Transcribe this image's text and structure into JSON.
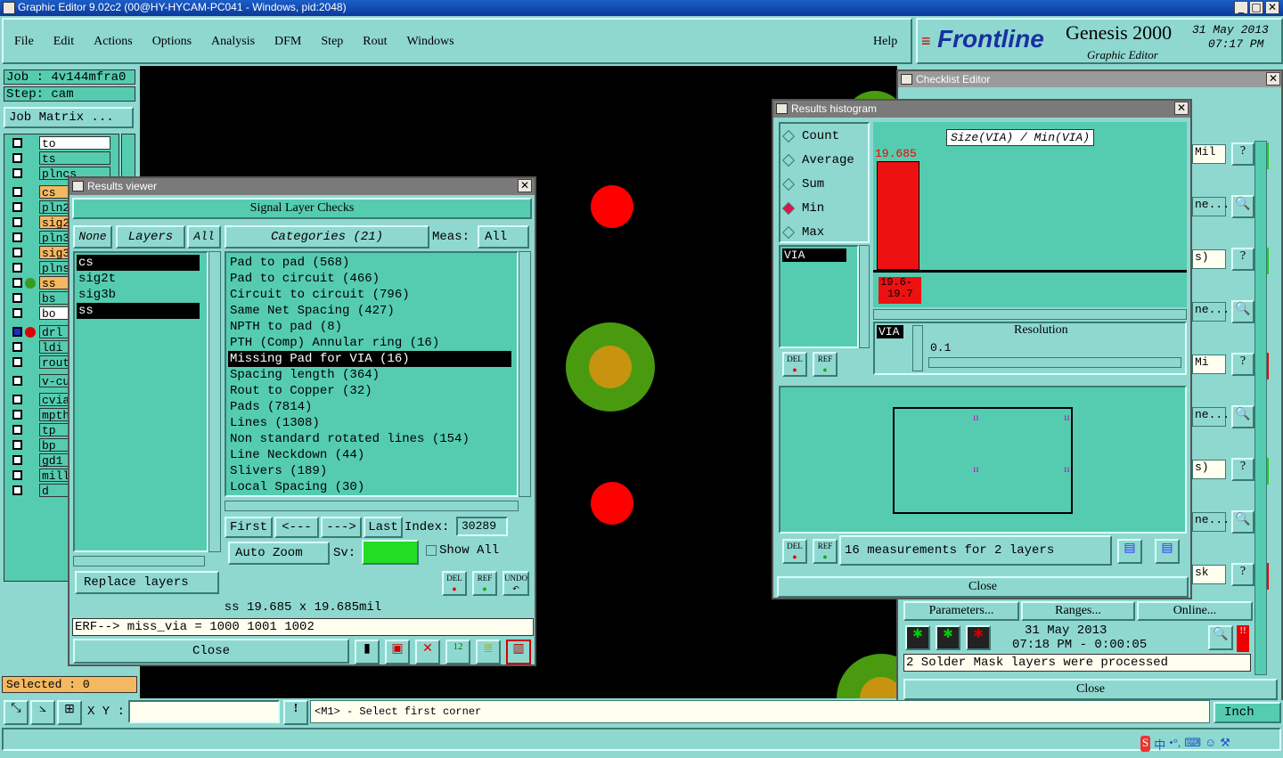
{
  "window": {
    "title": "Graphic Editor 9.02c2 (00@HY-HYCAM-PC041 - Windows, pid:2048)"
  },
  "menu": [
    "File",
    "Edit",
    "Actions",
    "Options",
    "Analysis",
    "DFM",
    "Step",
    "Rout",
    "Windows"
  ],
  "help": "Help",
  "brand": {
    "logo": "Frontline",
    "product": "Genesis 2000",
    "subtitle": "Graphic Editor",
    "date": "31 May 2013",
    "time": "07:17 PM"
  },
  "job": {
    "job_line": "Job : 4v144mfra0",
    "step_line": "Step: cam",
    "matrix_btn": "Job Matrix ..."
  },
  "layers": [
    {
      "name": "to",
      "bg": "#ffffff"
    },
    {
      "name": "ts",
      "bg": "#55ccb0"
    },
    {
      "name": "plncs",
      "bg": "#55ccb0"
    },
    {
      "name": "cs",
      "bg": "#f4b860"
    },
    {
      "name": "pln2t",
      "bg": "#55ccb0"
    },
    {
      "name": "sig2t",
      "bg": "#f4b860"
    },
    {
      "name": "pln3b",
      "bg": "#55ccb0"
    },
    {
      "name": "sig3b",
      "bg": "#f4b860"
    },
    {
      "name": "plnss",
      "bg": "#55ccb0"
    },
    {
      "name": "ss",
      "bg": "#f4b860",
      "dot": "#3a9a20"
    },
    {
      "name": "bs",
      "bg": "#55ccb0"
    },
    {
      "name": "bo",
      "bg": "#ffffff"
    },
    {
      "name": "drl",
      "bg": "#55ccb0",
      "dot": "#e00000",
      "blue": true
    },
    {
      "name": "ldi",
      "bg": "#55ccb0"
    },
    {
      "name": "rout",
      "bg": "#55ccb0"
    },
    {
      "name": "v-cut",
      "bg": "#55ccb0"
    },
    {
      "name": "cvia",
      "bg": "#55ccb0"
    },
    {
      "name": "mpth",
      "bg": "#55ccb0"
    },
    {
      "name": "tp",
      "bg": "#55ccb0"
    },
    {
      "name": "bp",
      "bg": "#55ccb0"
    },
    {
      "name": "gd1",
      "bg": "#55ccb0"
    },
    {
      "name": "mill",
      "bg": "#55ccb0"
    },
    {
      "name": "d",
      "bg": "#55ccb0"
    }
  ],
  "selected": "Selected : 0",
  "results_viewer": {
    "title": "Results viewer",
    "heading": "Signal Layer Checks",
    "none_btn": "None",
    "layers_btn": "Layers",
    "all_btn": "All",
    "categories_btn": "Categories (21)",
    "meas_label": "Meas:",
    "meas_value": "All",
    "layer_list": [
      "cs",
      "sig2t",
      "sig3b",
      "ss"
    ],
    "categories": [
      "Pad to pad (568)",
      "Pad to circuit (466)",
      "Circuit to circuit (796)",
      "Same Net Spacing (427)",
      "NPTH to pad (8)",
      "PTH (Comp) Annular ring (16)",
      "Missing Pad for VIA (16)",
      "Spacing length (364)",
      "Rout to Copper (32)",
      "Pads (7814)",
      "Lines (1308)",
      "Non standard rotated lines (154)",
      "Line Neckdown (44)",
      "Slivers (189)",
      "Local Spacing (30)"
    ],
    "selected_category": 6,
    "first": "First",
    "prev": "<---",
    "next": "--->",
    "last": "Last",
    "index_label": "Index:",
    "index_value": "30289",
    "autozoom": "Auto Zoom",
    "sv_label": "Sv:",
    "show_all": "Show All",
    "replace": "Replace layers",
    "del": "DEL",
    "ref": "REF",
    "undo": "UNDO",
    "status": "ss 19.685 x 19.685mil",
    "erf": "ERF--> miss_via = 1000 1001 1002",
    "close": "Close"
  },
  "histogram": {
    "title": "Results histogram",
    "options": [
      "Count",
      "Average",
      "Sum",
      "Min",
      "Max"
    ],
    "selected_option": 3,
    "list": [
      "VIA"
    ],
    "chart_title": "Size(VIA) / Min(VIA)",
    "bar_value": "19.685",
    "bar_range_1": "19.6-",
    "bar_range_2": "19.7",
    "via_label": "VIA",
    "resolution_label": "Resolution",
    "resolution_value": "0.1",
    "measurements": "16 measurements for 2 layers",
    "close": "Close",
    "del": "DEL",
    "ref": "REF"
  },
  "checklist": {
    "title": "Checklist Editor",
    "rows": [
      "Mil",
      "ne...",
      "s)",
      "ne...",
      "Mi",
      "ne...",
      "s)",
      "ne...",
      "sk"
    ],
    "params": "Parameters...",
    "ranges": "Ranges...",
    "online": "Online...",
    "date": "31 May 2013",
    "time": "07:18 PM - 0:00:05",
    "msg": "2 Solder Mask layers were processed",
    "close": "Close"
  },
  "bottom": {
    "xy_label": "X Y :",
    "xy_value": "",
    "prompt": "<M1> - Select first corner",
    "units": "Inch"
  },
  "tray": [
    "S",
    "中",
    "•°,",
    "⌨",
    "☺",
    "⚒"
  ]
}
